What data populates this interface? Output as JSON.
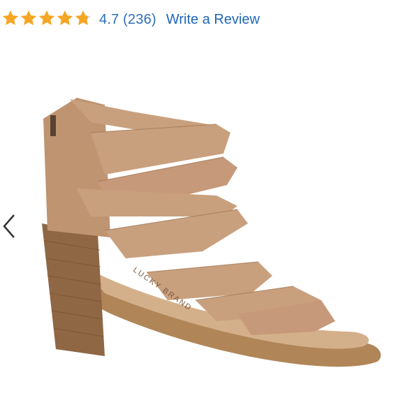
{
  "rating": {
    "score_value": 4.7,
    "max_stars": 5,
    "score_text": "4.7",
    "count_text": "(236)",
    "write_review_label": "Write a Review",
    "star_color": "#f6a623",
    "star_empty_color": "#d9d9d9",
    "link_color": "#2066b8"
  },
  "product_image": {
    "brand_text": "LUCKY BRAND",
    "upper_color": "#c9a07e",
    "heel_color": "#8f6744",
    "sole_color": "#b08658"
  },
  "navigation": {
    "prev_icon": "chevron-left-icon"
  }
}
